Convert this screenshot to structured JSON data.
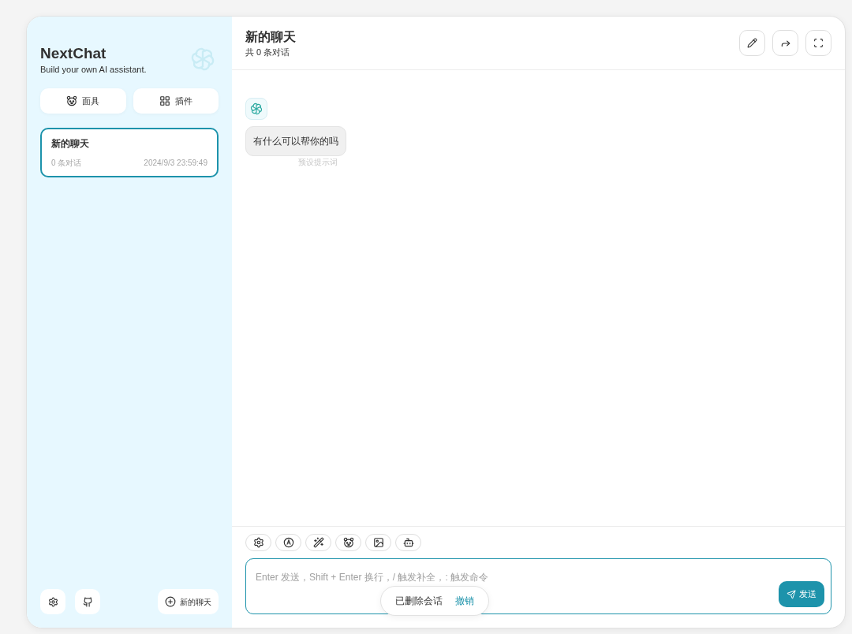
{
  "sidebar": {
    "title": "NextChat",
    "subtitle": "Build your own AI assistant.",
    "buttons": [
      {
        "kind": "mask",
        "label": "面具"
      },
      {
        "kind": "plugin",
        "label": "插件"
      }
    ],
    "sessions": [
      {
        "title": "新的聊天",
        "count": "0 条对话",
        "time": "2024/9/3 23:59:49",
        "selected": true
      }
    ],
    "new_chat": "新的聊天"
  },
  "header": {
    "title": "新的聊天",
    "subtitle": "共 0 条对话"
  },
  "messages": [
    {
      "text": "有什么可以帮你的吗",
      "hint": "预设提示词"
    }
  ],
  "input": {
    "placeholder": "Enter 发送，Shift + Enter 换行，/ 触发补全，: 触发命令",
    "send_label": "发送"
  },
  "toast": {
    "text": "已删除会话",
    "action": "撤销"
  }
}
